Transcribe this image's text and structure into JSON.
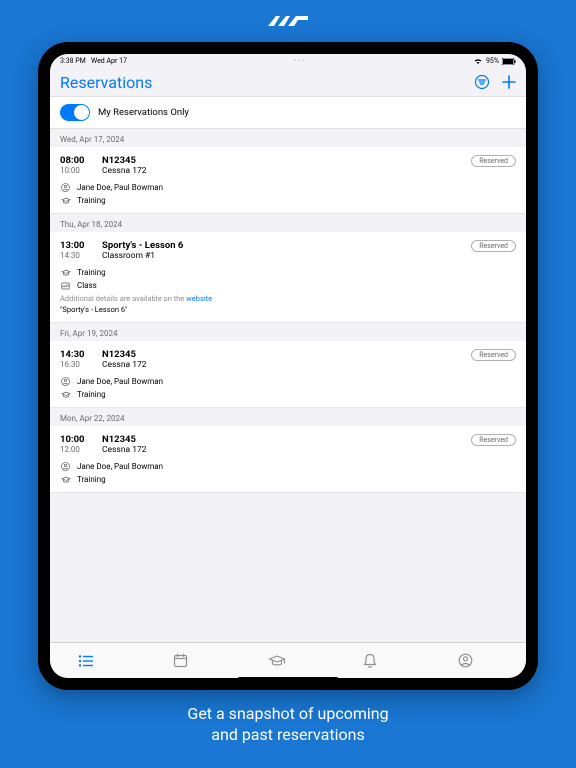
{
  "marketing": {
    "caption_line1": "Get a snapshot of upcoming",
    "caption_line2": "and past reservations"
  },
  "statusbar": {
    "time": "3:38 PM",
    "date": "Wed Apr 17",
    "wifi": "wifi-icon",
    "battery_pct": "95%"
  },
  "header": {
    "title": "Reservations",
    "filter_toggle_on": true,
    "filter_label": "My Reservations Only"
  },
  "sections": [
    {
      "date": "Wed, Apr 17, 2024",
      "items": [
        {
          "start": "08:00",
          "end": "10:00",
          "title": "N12345",
          "subtitle": "Cessna 172",
          "badge": "Reserved",
          "details": [
            {
              "icon": "person",
              "text": "Jane Doe, Paul Bowman"
            },
            {
              "icon": "grad",
              "text": "Training"
            }
          ]
        }
      ]
    },
    {
      "date": "Thu, Apr 18, 2024",
      "items": [
        {
          "start": "13:00",
          "end": "14:30",
          "title": "Sporty's - Lesson 6",
          "subtitle": "Classroom #1",
          "badge": "Reserved",
          "details": [
            {
              "icon": "grad",
              "text": "Training"
            },
            {
              "icon": "image",
              "text": "Class"
            }
          ],
          "note_prefix": "Additional details are available on the ",
          "note_link": "website",
          "quote": "\"Sporty's - Lesson 6\""
        }
      ]
    },
    {
      "date": "Fri, Apr 19, 2024",
      "items": [
        {
          "start": "14:30",
          "end": "16:30",
          "title": "N12345",
          "subtitle": "Cessna 172",
          "badge": "Reserved",
          "details": [
            {
              "icon": "person",
              "text": "Jane Doe, Paul Bowman"
            },
            {
              "icon": "grad",
              "text": "Training"
            }
          ]
        }
      ]
    },
    {
      "date": "Mon, Apr 22, 2024",
      "items": [
        {
          "start": "10:00",
          "end": "12:00",
          "title": "N12345",
          "subtitle": "Cessna 172",
          "badge": "Reserved",
          "details": [
            {
              "icon": "person",
              "text": "Jane Doe, Paul Bowman"
            },
            {
              "icon": "grad",
              "text": "Training"
            }
          ]
        }
      ]
    }
  ],
  "tabs": {
    "list": "list",
    "calendar": "calendar",
    "training": "grad",
    "notifications": "bell",
    "profile": "profile"
  }
}
